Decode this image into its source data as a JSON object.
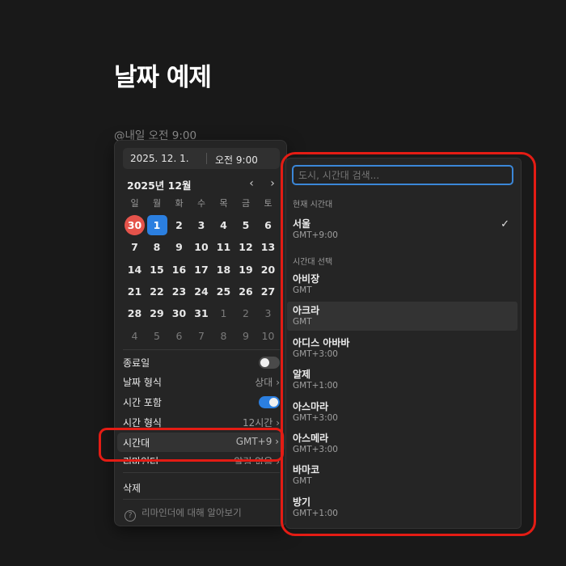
{
  "page": {
    "title": "날짜 예제",
    "mention": "@내일 오전 9:00"
  },
  "picker": {
    "date": "2025. 12. 1.",
    "time": "오전 9:00",
    "month_label": "2025년 12월",
    "prev": "‹",
    "next": "›",
    "weekdays": [
      "일",
      "월",
      "화",
      "수",
      "목",
      "금",
      "토"
    ],
    "weeks": [
      [
        "30",
        "1",
        "2",
        "3",
        "4",
        "5",
        "6"
      ],
      [
        "7",
        "8",
        "9",
        "10",
        "11",
        "12",
        "13"
      ],
      [
        "14",
        "15",
        "16",
        "17",
        "18",
        "19",
        "20"
      ],
      [
        "21",
        "22",
        "23",
        "24",
        "25",
        "26",
        "27"
      ],
      [
        "28",
        "29",
        "30",
        "31",
        "1",
        "2",
        "3"
      ],
      [
        "4",
        "5",
        "6",
        "7",
        "8",
        "9",
        "10"
      ]
    ],
    "options": {
      "end_date": "종료일",
      "end_date_on": false,
      "date_format": "날짜 형식",
      "date_format_value": "상대",
      "include_time": "시간 포함",
      "include_time_on": true,
      "time_format": "시간 형식",
      "time_format_value": "12시간",
      "timezone": "시간대",
      "timezone_value": "GMT+9",
      "reminder": "리마인더",
      "reminder_value": "알림 없음",
      "delete": "삭제",
      "help": "리마인더에 대해 알아보기"
    }
  },
  "tz": {
    "search_placeholder": "도시, 시간대 검색...",
    "current_section": "현재 시간대",
    "current": {
      "city": "서울",
      "offset": "GMT+9:00",
      "check": "✓"
    },
    "select_section": "시간대 선택",
    "items": [
      {
        "city": "아비장",
        "offset": "GMT"
      },
      {
        "city": "아크라",
        "offset": "GMT"
      },
      {
        "city": "아디스 아바바",
        "offset": "GMT+3:00"
      },
      {
        "city": "알제",
        "offset": "GMT+1:00"
      },
      {
        "city": "아스마라",
        "offset": "GMT+3:00"
      },
      {
        "city": "아스메라",
        "offset": "GMT+3:00"
      },
      {
        "city": "바마코",
        "offset": "GMT"
      },
      {
        "city": "방기",
        "offset": "GMT+1:00"
      }
    ]
  },
  "colors": {
    "accent": "#2b7fe0",
    "today": "#e5534b",
    "annotation": "#e41c14"
  }
}
